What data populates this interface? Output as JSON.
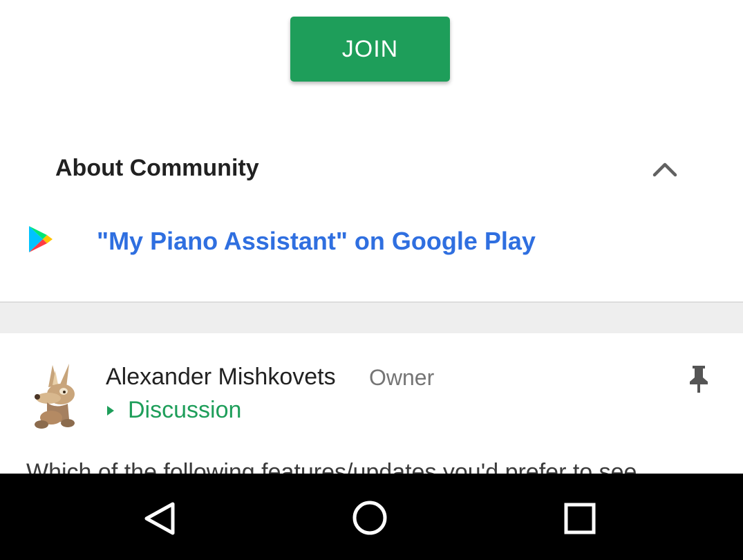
{
  "join_section": {
    "button_label": "JOIN",
    "button_color": "#1e9e5a"
  },
  "about": {
    "title": "About Community",
    "link_text": "\"My Piano Assistant\" on Google Play",
    "link_color": "#2f6fe0",
    "icons": {
      "toggle": "chevron-up-icon",
      "link": "google-play-icon"
    }
  },
  "post": {
    "author": "Alexander Mishkovets",
    "role": "Owner",
    "category": "Discussion",
    "category_color": "#1e9e5a",
    "body_preview": "Which of the following features/updates you'd prefer to see",
    "icons": {
      "pin": "pin-icon",
      "avatar": "avatar",
      "category": "caret-right-icon"
    }
  },
  "navbar": {
    "icons": [
      "back-icon",
      "home-icon",
      "recents-icon"
    ]
  }
}
